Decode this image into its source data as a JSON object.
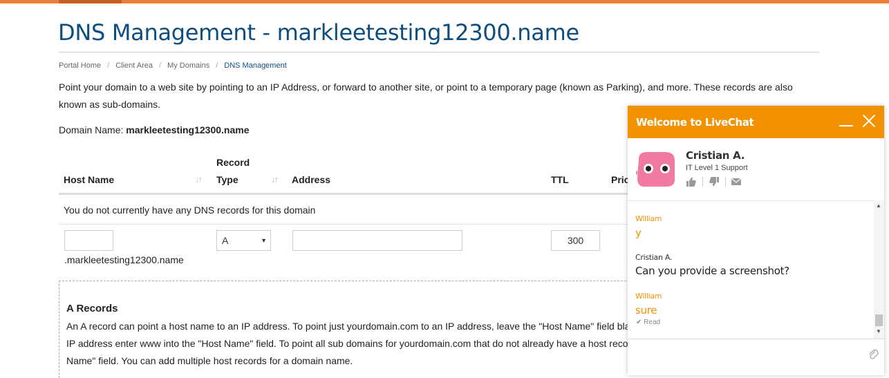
{
  "page": {
    "title": "DNS Management - markleetesting12300.name",
    "breadcrumb": [
      "Portal Home",
      "Client Area",
      "My Domains",
      "DNS Management"
    ],
    "intro": "Point your domain to a web site by pointing to an IP Address, or forward to another site, or point to a temporary page (known as Parking), and more. These records are also known as sub-domains.",
    "domain_label": "Domain Name:",
    "domain_name": "markleetesting12300.name"
  },
  "table": {
    "headers": {
      "host_name": "Host Name",
      "record_type_line1": "Record",
      "record_type_line2": "Type",
      "address": "Address",
      "ttl": "TTL",
      "priority": "Pric"
    },
    "empty_message": "You do not currently have any DNS records for this domain",
    "new_row": {
      "host_value": "",
      "record_type": "A",
      "address_value": "",
      "ttl_value": "300",
      "suffix": ".markleetesting12300.name"
    }
  },
  "info": {
    "a_records_title": "A Records",
    "a_records_lines": [
      "An A record can point a host name to an IP address. To point just yourdomain.com to an IP address, leave the \"Host Name\" field bla",
      "IP address enter www into the \"Host Name\" field. To point all sub domains for yourdomain.com that do not already have a host reco",
      "Name\" field. You can add multiple host records for a domain name."
    ]
  },
  "chat": {
    "header_title": "Welcome to LiveChat",
    "agent_name": "Cristian A.",
    "agent_role": "IT Level 1 Support",
    "messages": [
      {
        "author": "William",
        "text": "y",
        "from": "visitor"
      },
      {
        "author": "Cristian A.",
        "text": "Can you provide a screenshot?",
        "from": "agent"
      },
      {
        "author": "William",
        "text": "sure",
        "from": "visitor"
      }
    ],
    "read_status": "✔ Read",
    "colors": {
      "header": "#f39200",
      "visitor_text": "#f39200"
    },
    "icons": [
      "thumbs-up-icon",
      "thumbs-down-icon",
      "email-icon",
      "minimize-icon",
      "close-icon",
      "paperclip-icon"
    ]
  },
  "colors": {
    "accent": "#ee7f3a",
    "title": "#0e4e7e"
  }
}
